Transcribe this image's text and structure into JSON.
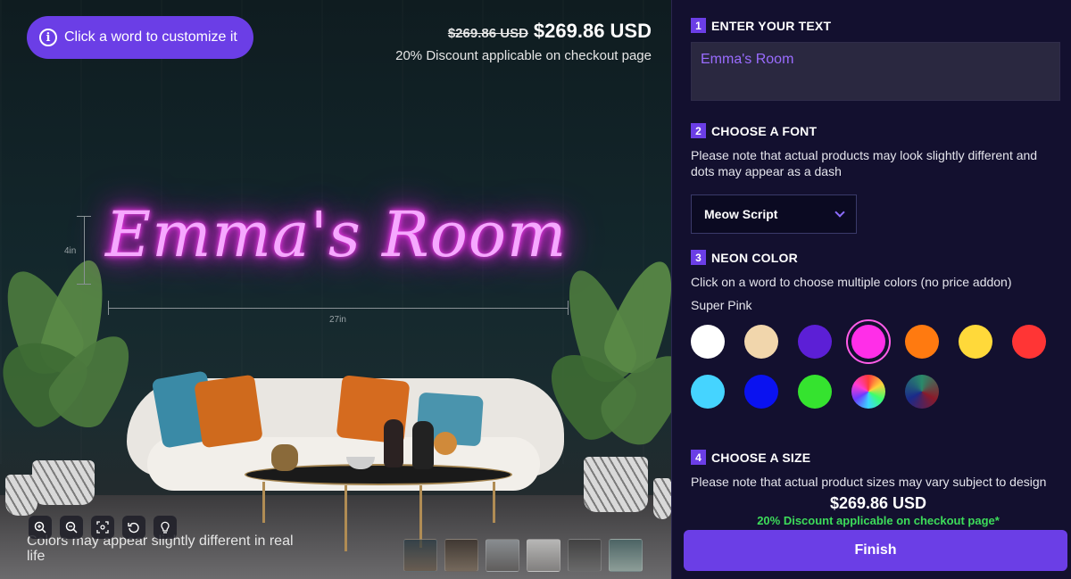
{
  "preview": {
    "customize_label": "Click a word to customize it",
    "old_price": "$269.86 USD",
    "new_price": "$269.86 USD",
    "discount_note": "20% Discount applicable on checkout page",
    "neon_text": "Emma's Room",
    "height_label": "4in",
    "width_label": "27in",
    "colors_note": "Colors may appear slightly different in real life",
    "toolbar": [
      "zoom-in-icon",
      "zoom-out-icon",
      "fit-screen-icon",
      "reset-icon",
      "lightbulb-icon"
    ],
    "thumbnail_count": 6
  },
  "panel": {
    "step1": {
      "num": "1",
      "title": "ENTER YOUR TEXT",
      "value": "Emma's Room"
    },
    "step2": {
      "num": "2",
      "title": "CHOOSE A FONT",
      "note": "Please note that actual products may look slightly different and dots may appear as a dash",
      "selected_font": "Meow Script"
    },
    "step3": {
      "num": "3",
      "title": "NEON COLOR",
      "note": "Click on a word to choose multiple colors (no price addon)",
      "selected_color_name": "Super Pink",
      "colors": [
        "#ffffff",
        "#f1d6ac",
        "#5c1fd6",
        "#ff2ee8",
        "#ff7a10",
        "#ffd93a",
        "#ff3535",
        "#45d4ff",
        "#0a12f0",
        "#35e32f",
        "rainbow",
        "multicolor"
      ],
      "selected_index": 3
    },
    "step4": {
      "num": "4",
      "title": "CHOOSE A SIZE",
      "note": "Please note that actual product sizes may vary subject to design"
    }
  },
  "footer": {
    "total": "$269.86 USD",
    "discount": "20% Discount applicable on checkout page*",
    "finish_label": "Finish"
  }
}
